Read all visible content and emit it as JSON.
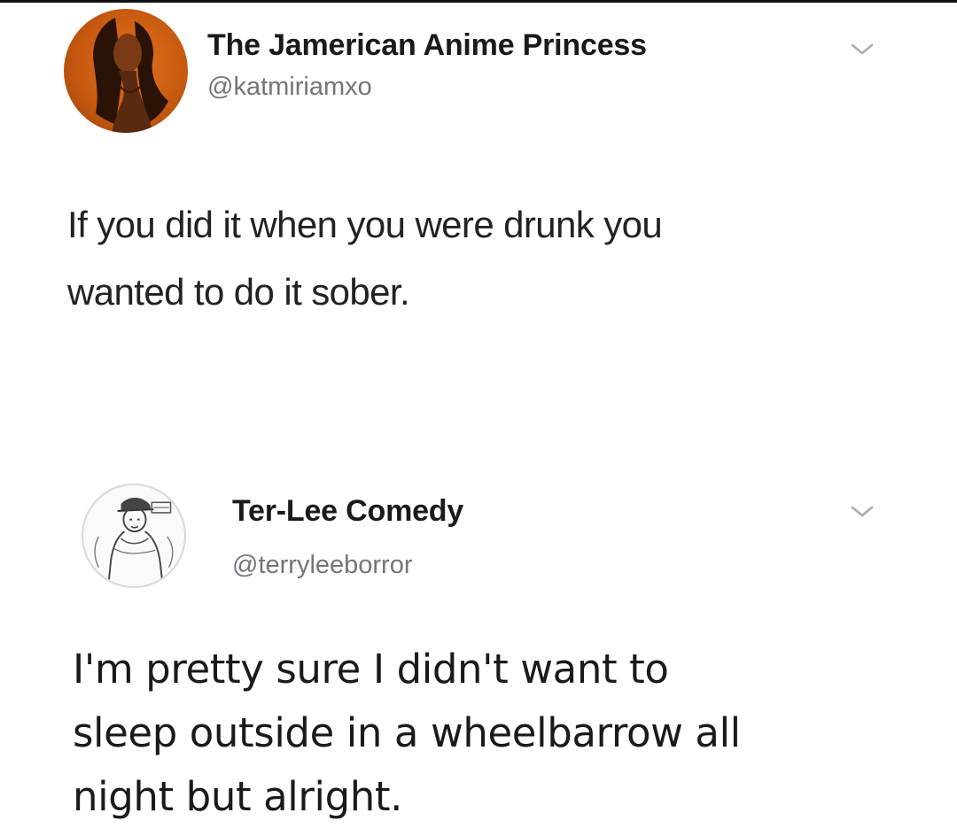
{
  "tweets": [
    {
      "display_name": "The Jamerican Anime Princess",
      "handle": "@katmiriamxo",
      "text": "If you did it when you were drunk you\nwanted to do it sober.",
      "avatar_icon": "profile-photo-icon",
      "menu_icon": "chevron-down-icon"
    },
    {
      "display_name": "Ter-Lee Comedy",
      "handle": "@terryleeborror",
      "text": "I'm pretty sure I didn't want to\nsleep outside in a wheelbarrow all\nnight but alright.",
      "avatar_icon": "profile-sketch-icon",
      "menu_icon": "chevron-down-icon"
    }
  ],
  "colors": {
    "background": "#ffffff",
    "name_text": "#1a1a1a",
    "handle_text": "#6e767d",
    "avatar_1_bg": "#d2661a",
    "chevron": "#a6adb3"
  }
}
